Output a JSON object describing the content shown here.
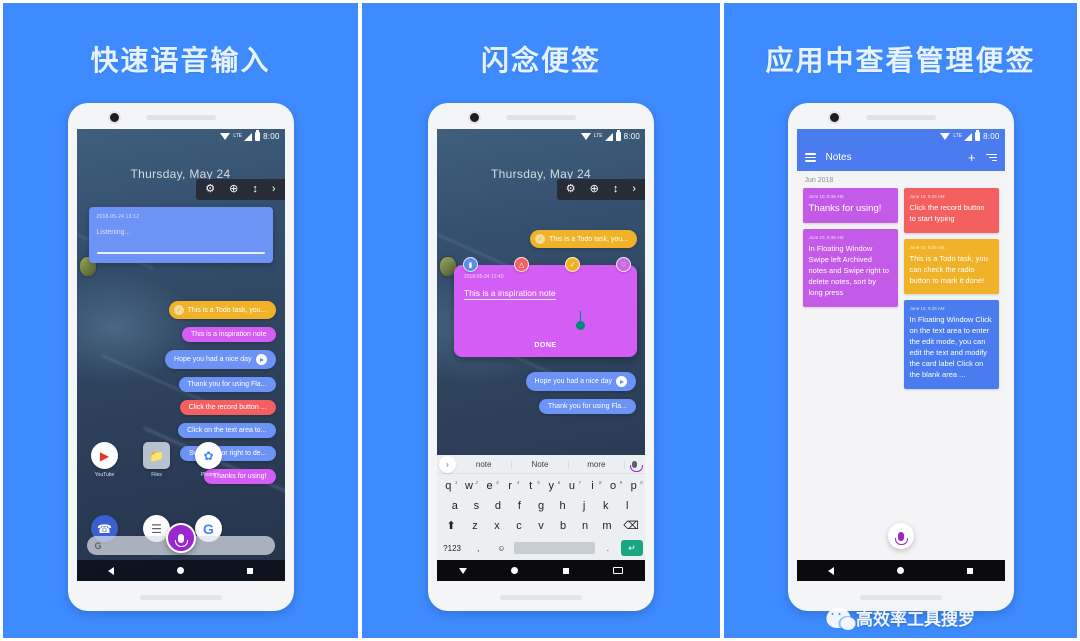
{
  "poster": {
    "background_color": "#3d8bff",
    "watermark": {
      "text": "高效率工具搜罗",
      "icon": "wechat-logo"
    }
  },
  "panels": [
    {
      "title": "快速语音输入"
    },
    {
      "title": "闪念便签"
    },
    {
      "title": "应用中查看管理便签"
    }
  ],
  "status_bar": {
    "time": "8:00",
    "network": "LTE",
    "icons": [
      "wifi-icon",
      "signal-icon",
      "battery-icon"
    ]
  },
  "home_screen": {
    "date": "Thursday, May 24",
    "toolbar": {
      "settings": "⚙",
      "add": "⊕",
      "resize": "↕",
      "collapse": "›"
    },
    "listening_card": {
      "timestamp": "2018-05-24 13:12",
      "body": "Listening..."
    },
    "search_bar": {
      "logo": "G",
      "placeholder": ""
    },
    "mic_fab": "mic-icon",
    "nav": {
      "back": "back-icon",
      "home": "home-icon",
      "recents": "recents-icon"
    }
  },
  "pills": [
    {
      "text": "This is a Todo task, you...",
      "color": "#f0b228",
      "badge": "todo-check-icon"
    },
    {
      "text": "This is a  inspiration note",
      "color": "#d45ef5"
    },
    {
      "text": "Hope you had a nice day",
      "color": "#6e93f7",
      "play": "play-icon"
    },
    {
      "text": "Thank you for using Fla...",
      "color": "#6e93f7"
    },
    {
      "text": "Click the record button ...",
      "color": "#f4605f"
    },
    {
      "text": "Click on the text area to...",
      "color": "#6e93f7"
    },
    {
      "text": "Swipe left or right to de...",
      "color": "#6e93f7"
    },
    {
      "text": "Thanks for using!",
      "color": "#d45ef5"
    }
  ],
  "app_icons_row1": [
    {
      "label": "YouTube",
      "glyph": "▶",
      "color": "#ffffff",
      "fg": "#e8322a",
      "name": "youtube-icon"
    },
    {
      "label": "Files",
      "glyph": "☰",
      "color": "#b7c2cf",
      "fg": "#ffffff",
      "name": "files-icon"
    },
    {
      "label": "Photos",
      "glyph": "✿",
      "color": "#ffffff",
      "fg": "#4285f4",
      "name": "photos-icon"
    }
  ],
  "app_icons_row2": [
    {
      "label": "",
      "glyph": "☎",
      "color": "#3a5fd0",
      "fg": "#ffffff",
      "name": "phone-icon"
    },
    {
      "label": "",
      "glyph": "≣",
      "color": "#ffffff",
      "fg": "#5f6368",
      "name": "messages-icon"
    },
    {
      "label": "",
      "glyph": "G",
      "color": "#ffffff",
      "fg": "#4285f4",
      "name": "google-icon"
    }
  ],
  "edit_card": {
    "timestamp": "2018-05-24 12:40",
    "text": "This is a  inspiration note",
    "done_label": "DONE",
    "color": "#d45ef5",
    "color_dots": [
      {
        "name": "label-blue",
        "color": "#5b8def",
        "glyph": "▮"
      },
      {
        "name": "label-red",
        "color": "#f4605f",
        "glyph": "△"
      },
      {
        "name": "label-yellow",
        "color": "#f0b228",
        "glyph": "✓"
      },
      {
        "name": "label-purple",
        "color": "#c86ae0",
        "glyph": "♡"
      }
    ],
    "todo_pill": "This is a Todo task, you...",
    "pills_below": [
      {
        "text": "Hope you had a nice day",
        "color": "#6e93f7",
        "play": "play-icon"
      },
      {
        "text": "Thank you for using Fla...",
        "color": "#6e93f7"
      }
    ]
  },
  "keyboard": {
    "suggestions": [
      "note",
      "Note",
      "more"
    ],
    "mic": "mic-icon",
    "expand": "›",
    "row1": [
      {
        "k": "q",
        "n": "1"
      },
      {
        "k": "w",
        "n": "2"
      },
      {
        "k": "e",
        "n": "3"
      },
      {
        "k": "r",
        "n": "4"
      },
      {
        "k": "t",
        "n": "5"
      },
      {
        "k": "y",
        "n": "6"
      },
      {
        "k": "u",
        "n": "7"
      },
      {
        "k": "i",
        "n": "8"
      },
      {
        "k": "o",
        "n": "9"
      },
      {
        "k": "p",
        "n": "0"
      }
    ],
    "row2": [
      "a",
      "s",
      "d",
      "f",
      "g",
      "h",
      "j",
      "k",
      "l"
    ],
    "row3": [
      "z",
      "x",
      "c",
      "v",
      "b",
      "n",
      "m"
    ],
    "shift": "⬆",
    "delete": "⌫",
    "numbers": "?123",
    "comma": ",",
    "emoji": "☺",
    "period": ".",
    "enter": "↵"
  },
  "notes_app": {
    "title": "Notes",
    "menu_icon": "hamburger-icon",
    "add_icon": "plus-icon",
    "sort_icon": "sort-icon",
    "month": "Jun 2018",
    "fab": "mic-icon",
    "cards_left": [
      {
        "time": "June 10, 9:36 AM",
        "text": "Thanks for using!",
        "color": "#c45ae8",
        "big": true
      },
      {
        "time": "June 10, 9:36 AM",
        "text": "In Floating Window Swipe left Archived notes and Swipe right to delete notes, sort by long press",
        "color": "#c45ae8"
      }
    ],
    "cards_right": [
      {
        "time": "June 10, 9:36 AM",
        "text": "Click the record button to start typing",
        "color": "#f4605f"
      },
      {
        "time": "June 10, 9:36 AM",
        "text": "This is a Todo task, you can check the radio button to mark it done!",
        "color": "#f0b228"
      },
      {
        "time": "June 10, 9:36 AM",
        "text": "In Floating Window Click on the text area to enter the edit mode, you can edit the text and modify the card label Click on the blank area ...",
        "color": "#4a7cf0"
      }
    ]
  }
}
